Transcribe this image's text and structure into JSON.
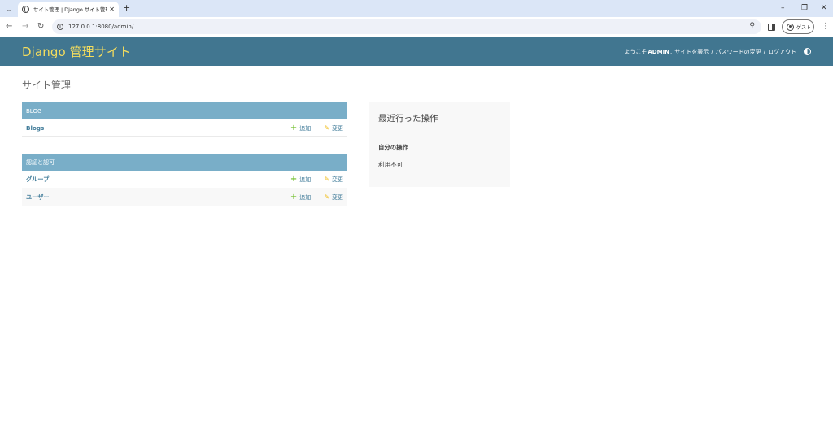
{
  "browser": {
    "tab_title": "サイト管理 | Django サイト管理",
    "url": "127.0.0.1:8080/admin/",
    "guest_label": "ゲスト"
  },
  "header": {
    "branding": "Django 管理サイト",
    "welcome": "ようこそ",
    "username": "ADMIN",
    "view_site": "サイトを表示",
    "change_password": "パスワードの変更",
    "logout": "ログアウト"
  },
  "content": {
    "title": "サイト管理",
    "apps": [
      {
        "name": "BLOG",
        "models": [
          {
            "name": "Blogs",
            "add": "追加",
            "change": "変更"
          }
        ]
      },
      {
        "name": "認証と認可",
        "models": [
          {
            "name": "グループ",
            "add": "追加",
            "change": "変更"
          },
          {
            "name": "ユーザー",
            "add": "追加",
            "change": "変更"
          }
        ]
      }
    ]
  },
  "recent_actions": {
    "title": "最近行った操作",
    "subtitle": "自分の操作",
    "empty": "利用不可"
  },
  "colors": {
    "header_bg": "#417690",
    "branding": "#f5dd5d",
    "caption_bg": "#79aec8",
    "link": "#447e9b",
    "add_icon": "#70bf2b",
    "change_icon": "#efb80b"
  }
}
